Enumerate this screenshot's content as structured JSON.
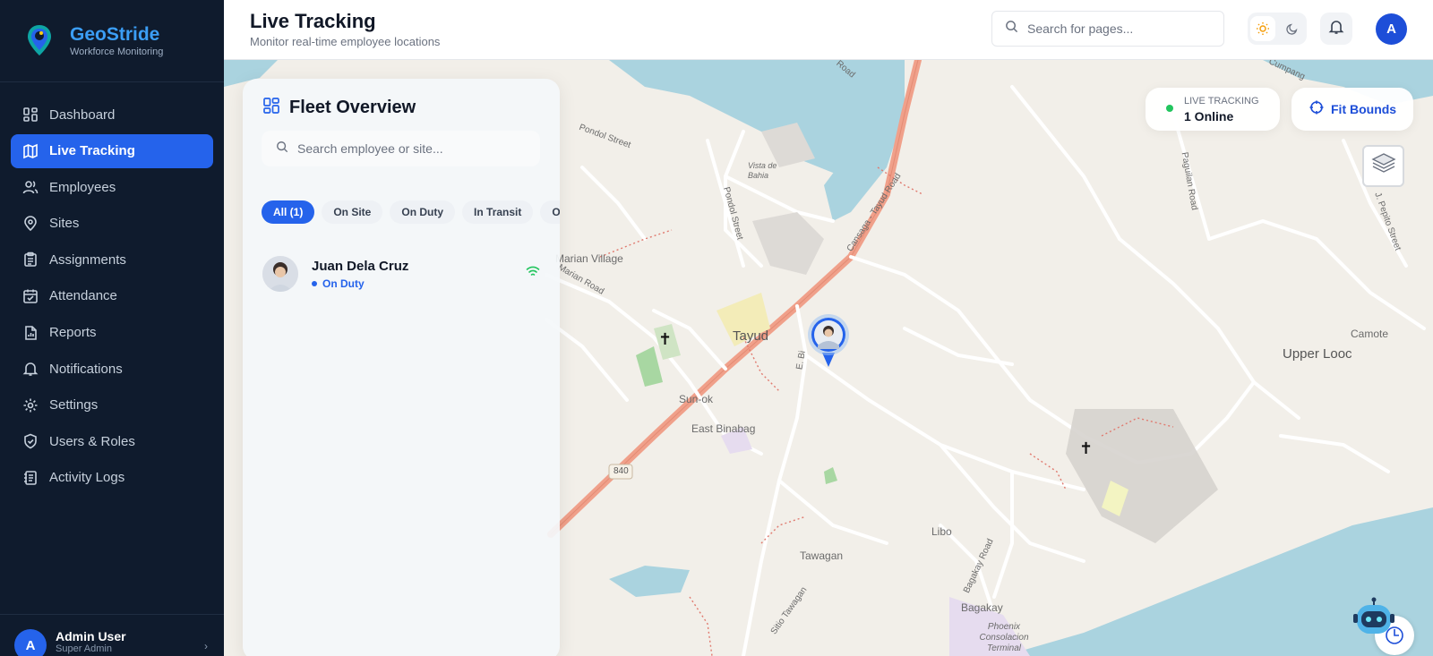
{
  "brand": {
    "title": "GeoStride",
    "subtitle": "Workforce Monitoring"
  },
  "nav": [
    {
      "label": "Dashboard",
      "icon": "dashboard-icon",
      "active": false
    },
    {
      "label": "Live Tracking",
      "icon": "map-icon",
      "active": true
    },
    {
      "label": "Employees",
      "icon": "users-icon",
      "active": false
    },
    {
      "label": "Sites",
      "icon": "map-pin-icon",
      "active": false
    },
    {
      "label": "Assignments",
      "icon": "clipboard-icon",
      "active": false
    },
    {
      "label": "Attendance",
      "icon": "calendar-check-icon",
      "active": false
    },
    {
      "label": "Reports",
      "icon": "file-chart-icon",
      "active": false
    },
    {
      "label": "Notifications",
      "icon": "bell-icon",
      "active": false
    },
    {
      "label": "Settings",
      "icon": "gear-icon",
      "active": false
    },
    {
      "label": "Users & Roles",
      "icon": "shield-check-icon",
      "active": false
    },
    {
      "label": "Activity Logs",
      "icon": "log-icon",
      "active": false
    }
  ],
  "user": {
    "initial": "A",
    "name": "Admin User",
    "role": "Super Admin"
  },
  "header": {
    "title": "Live Tracking",
    "subtitle": "Monitor real-time employee locations",
    "search_placeholder": "Search for pages...",
    "avatar_initial": "A"
  },
  "fleet": {
    "title": "Fleet Overview",
    "search_placeholder": "Search employee or site...",
    "filters": [
      "All (1)",
      "On Site",
      "On Duty",
      "In Transit",
      "Offline"
    ],
    "active_filter": "All (1)",
    "employees": [
      {
        "name": "Juan Dela Cruz",
        "status": "On Duty"
      }
    ]
  },
  "live": {
    "label": "LIVE TRACKING",
    "value": "1 Online"
  },
  "fit_bounds": "Fit Bounds",
  "map_labels": {
    "tayud": "Tayud",
    "sun_ok": "Sun-ok",
    "east_binabag": "East Binabag",
    "libo": "Libo",
    "tawagan": "Tawagan",
    "bagakay": "Bagakay",
    "upper_looc": "Upper Looc",
    "camote": "Camote",
    "marian_village": "Marian Village",
    "vista_de_bahia": "Vista de Bahia",
    "road_840": "840",
    "pondol_street": "Pondol Street",
    "cansaga_road": "Cansaga - Tayud Road",
    "phoenix": "Phoenix Consolacion Terminal",
    "bagakay_road": "Bagakay Road",
    "marian_road": "Marian Road",
    "paguilan_road": "Paguilan Road",
    "sitio_tawagan": "Sitio Tawagan",
    "j_pepito": "J. Pepito Street",
    "cumpang": "Cumpang",
    "road_fragment": "Road",
    "e_bi": "E. Bi"
  },
  "colors": {
    "sidebar_bg": "#0f1b2d",
    "accent": "#2563eb",
    "brand": "#3b9ef5",
    "water": "#aad3df",
    "major_road": "#f0a08a",
    "online": "#22c55e"
  }
}
